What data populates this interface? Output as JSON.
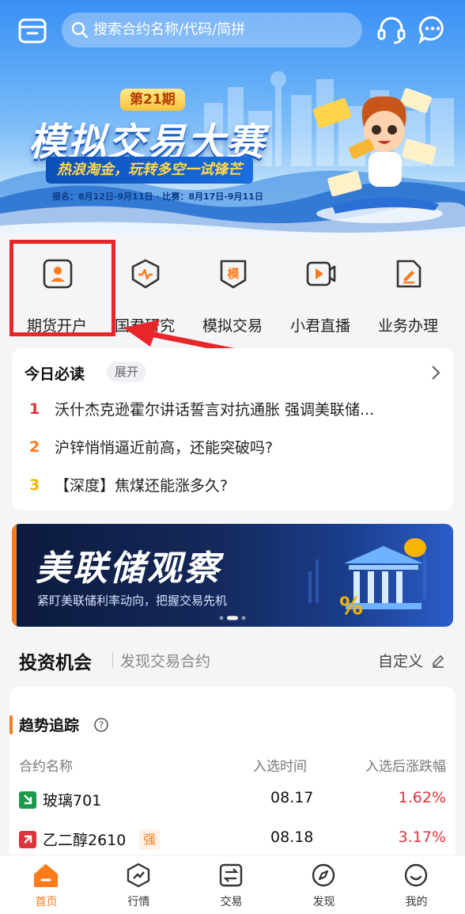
{
  "search": {
    "placeholder": "搜索合约名称/代码/简拼"
  },
  "hero": {
    "issue": "第21期",
    "title": "模拟交易大赛",
    "slogan": "热浪淘金，玩转多空一试锋芒",
    "dates": "报名：8月12日-9月11日 · 比赛：8月17日-9月11日"
  },
  "shortcuts": [
    {
      "label": "期货开户",
      "icon": "user-card-icon"
    },
    {
      "label": "国君研究",
      "icon": "research-shield-icon"
    },
    {
      "label": "模拟交易",
      "icon": "simulate-badge-icon",
      "glyph": "模"
    },
    {
      "label": "小君直播",
      "icon": "live-video-icon"
    },
    {
      "label": "业务办理",
      "icon": "document-edit-icon"
    }
  ],
  "today": {
    "title": "今日必读",
    "expand": "展开",
    "news": [
      {
        "rank": "1",
        "text": "沃什杰克逊霍尔讲话誓言对抗通胀 强调美联储...",
        "color": "#e0323b"
      },
      {
        "rank": "2",
        "text": "沪锌悄悄逼近前高，还能突破吗?",
        "color": "#ff7a1a"
      },
      {
        "rank": "3",
        "text": "【深度】焦煤还能涨多久?",
        "color": "#f4b400"
      }
    ]
  },
  "fed_banner": {
    "title": "美联储观察",
    "subtitle": "紧盯美联储利率动向，把握交易先机"
  },
  "invest": {
    "title": "投资机会",
    "subtitle": "发现交易合约",
    "custom": "自定义"
  },
  "trend": {
    "title": "趋势追踪",
    "headers": {
      "name": "合约名称",
      "time": "入选时间",
      "change": "入选后涨跌幅"
    },
    "rows": [
      {
        "name": "玻璃701",
        "time": "08.17",
        "change": "1.62%",
        "direction": "down",
        "tag": ""
      },
      {
        "name": "乙二醇2610",
        "time": "08.18",
        "change": "3.17%",
        "direction": "up",
        "tag": "强"
      }
    ]
  },
  "nav": [
    {
      "label": "首页",
      "icon": "home-icon",
      "active": true
    },
    {
      "label": "行情",
      "icon": "market-icon",
      "active": false
    },
    {
      "label": "交易",
      "icon": "trade-icon",
      "active": false
    },
    {
      "label": "发现",
      "icon": "compass-icon",
      "active": false
    },
    {
      "label": "我的",
      "icon": "profile-icon",
      "active": false
    }
  ],
  "colors": {
    "accent": "#ff7a1a",
    "up": "#e0323b",
    "down_badge": "#1a9a4a",
    "highlight": "#e8262a"
  }
}
